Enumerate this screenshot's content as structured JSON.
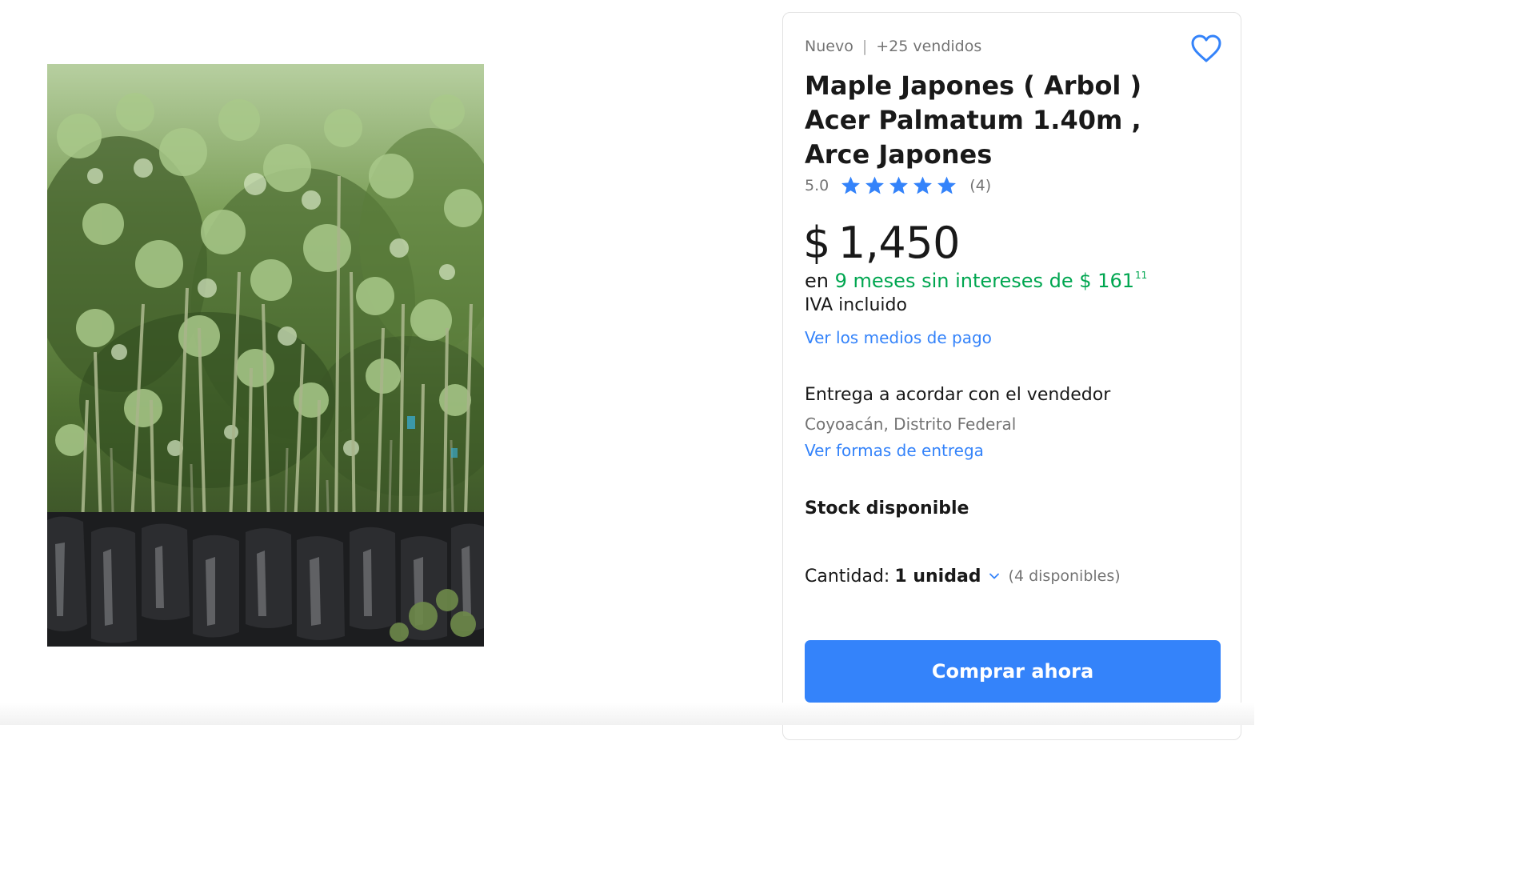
{
  "product": {
    "condition": "Nuevo",
    "separator": "|",
    "sold": "+25 vendidos",
    "title": "Maple Japones ( Arbol ) Acer Palmatum 1.40m , Arce Japones",
    "image_alt": "Maple japonés en bolsas de vivero"
  },
  "rating": {
    "score": "5.0",
    "stars": 5,
    "count": "(4)",
    "star_color": "#3483fa"
  },
  "price": {
    "currency": "$",
    "amount": "1,450",
    "installments_prefix": "en",
    "installments_text": "9 meses sin intereses de $ 161",
    "installments_cents": "11",
    "tax_note": "IVA incluido",
    "payment_link": "Ver los medios de pago"
  },
  "shipping": {
    "title": "Entrega a acordar con el vendedor",
    "location": "Coyoacán, Distrito Federal",
    "link": "Ver formas de entrega"
  },
  "stock": {
    "label": "Stock disponible"
  },
  "quantity": {
    "label": "Cantidad:",
    "value": "1 unidad",
    "available": "(4 disponibles)"
  },
  "actions": {
    "buy_label": "Comprar ahora"
  },
  "icons": {
    "favorite": "heart-icon",
    "star": "star-icon",
    "chevron": "chevron-down-icon"
  },
  "colors": {
    "accent": "#3483fa",
    "installments_green": "#00a650"
  }
}
